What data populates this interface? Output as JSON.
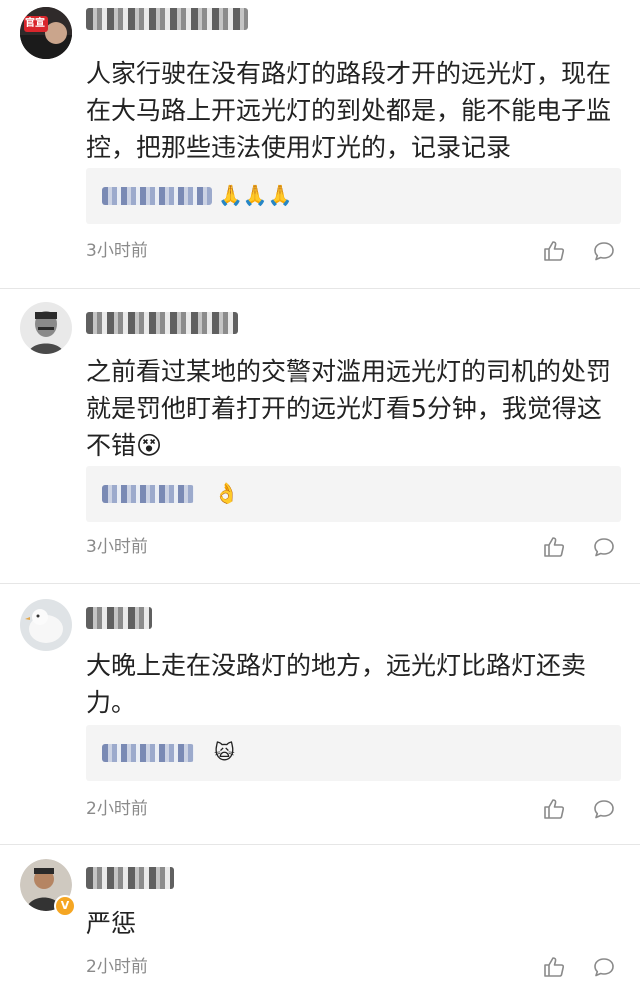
{
  "comments": [
    {
      "text": "人家行驶在没有路灯的路段才开的远光灯，现在在大马路上开远光灯的到处都是，能不能电子监控，把那些违法使用灯光的，记录记录",
      "reply_emoji": "🙏🙏🙏",
      "time": "3小时前",
      "avatar_badge": "官宣"
    },
    {
      "text": "之前看过某地的交警对滥用远光灯的司机的处罚就是罚他盯着打开的远光灯看5分钟，我觉得这不错😵",
      "reply_emoji": "👌",
      "time": "3小时前"
    },
    {
      "text": "大晚上走在没路灯的地方，远光灯比路灯还卖力。",
      "reply_emoji": "🙀",
      "time": "2小时前"
    },
    {
      "text": "严惩",
      "time": "2小时前",
      "verified_badge": "V"
    }
  ]
}
